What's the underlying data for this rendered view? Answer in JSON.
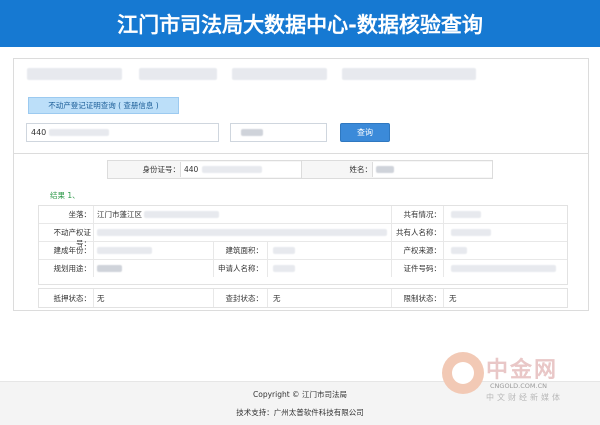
{
  "header": {
    "title": "江门市司法局大数据中心-数据核验查询"
  },
  "query": {
    "tab_label": "不动产登记证明查询 ( 查册信息 )",
    "id_input_value": "440",
    "query_button": "查询"
  },
  "summary": {
    "id_label": "身份证号：",
    "id_value": "440",
    "name_label": "姓名："
  },
  "result": {
    "title": "结果 1、",
    "rows": [
      {
        "l1": "坐落：",
        "v1": "江门市蓬江区",
        "l3": "共有情况："
      },
      {
        "l1": "不动产权证号：",
        "v1": "",
        "l3": "共有人名称："
      },
      {
        "l1": "建成年份：",
        "l2": "建筑面积：",
        "l3": "产权来源："
      },
      {
        "l1": "规划用途：",
        "l2": "申请人名称：",
        "l3": "证件号码："
      }
    ],
    "status": [
      {
        "label": "抵押状态：",
        "value": "无"
      },
      {
        "label": "查封状态：",
        "value": "无"
      },
      {
        "label": "限制状态：",
        "value": "无"
      }
    ]
  },
  "footer": {
    "copyright": "Copyright © 江门市司法局",
    "support": "技术支持：广州太普软件科技有限公司"
  },
  "watermark": {
    "name": "中金网",
    "url": "CNGOLD.COM.CN",
    "subtitle": "中文财经新媒体"
  },
  "colors": {
    "header": "#1679d2",
    "button": "#3b8ad9",
    "tab": "#bcdff9"
  }
}
